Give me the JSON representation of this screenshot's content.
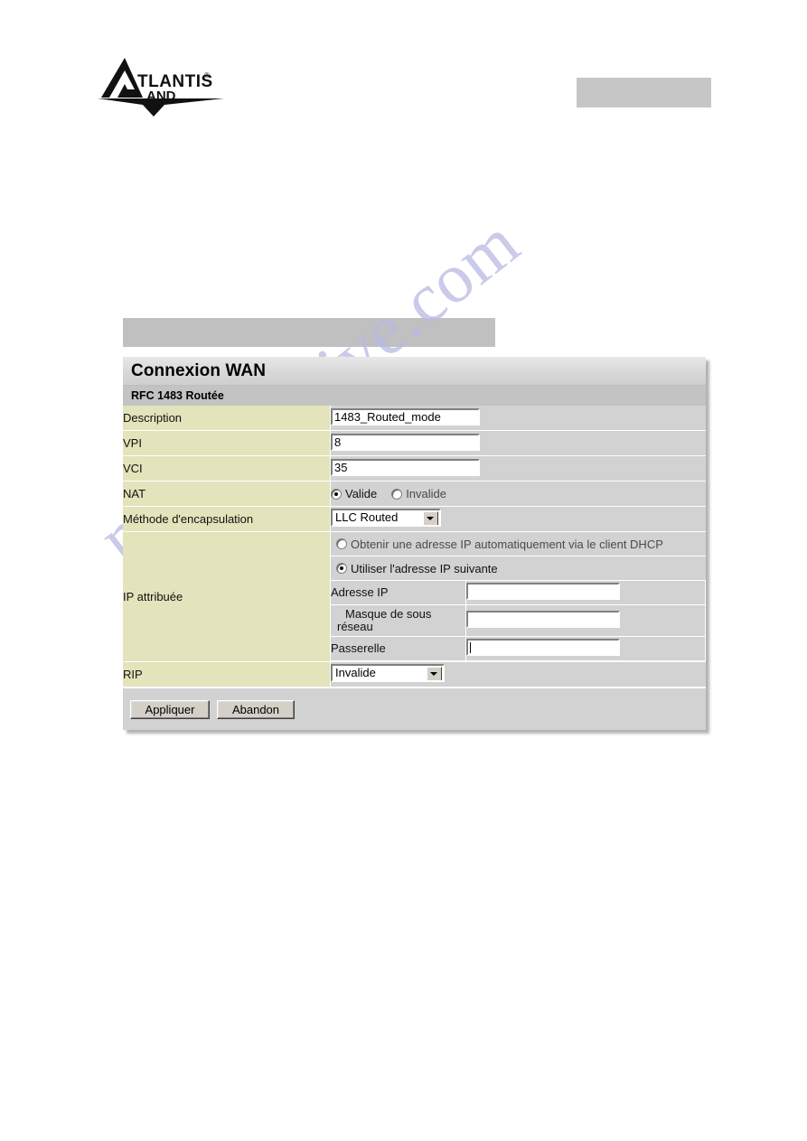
{
  "brand": {
    "logo_text_primary": "ATLANTIS",
    "logo_text_secondary": "LAND",
    "logo_registered_mark": "®",
    "logo_icon": "atlantis-land-logo"
  },
  "watermark": {
    "text": "manualshive.com",
    "color": "#b9b9e4"
  },
  "panel": {
    "title": "Connexion WAN",
    "subtitle": "RFC 1483 Routée",
    "rows": {
      "description": {
        "label": "Description",
        "value": "1483_Routed_mode"
      },
      "vpi": {
        "label": "VPI",
        "value": "8"
      },
      "vci": {
        "label": "VCI",
        "value": "35"
      },
      "nat": {
        "label": "NAT",
        "option_enabled": "Valide",
        "option_disabled": "Invalide",
        "selected": "Valide"
      },
      "encapsulation": {
        "label": "Méthode d'encapsulation",
        "value": "LLC Routed",
        "icon": "chevron-down-icon"
      },
      "assigned_ip": {
        "label": "IP attribuée",
        "option_dhcp": "Obtenir une adresse IP automatiquement via le client DHCP",
        "option_static": "Utiliser l'adresse IP suivante",
        "selected": "Utiliser l'adresse IP suivante",
        "fields": [
          {
            "label": "Adresse IP",
            "value": ""
          },
          {
            "label_line1": "Masque de sous",
            "label_line2": "réseau",
            "value": ""
          },
          {
            "label": "Passerelle",
            "value": ""
          }
        ]
      },
      "rip": {
        "label": "RIP",
        "value": "Invalide",
        "icon": "chevron-down-icon"
      }
    },
    "buttons": {
      "apply": "Appliquer",
      "cancel": "Abandon"
    }
  }
}
